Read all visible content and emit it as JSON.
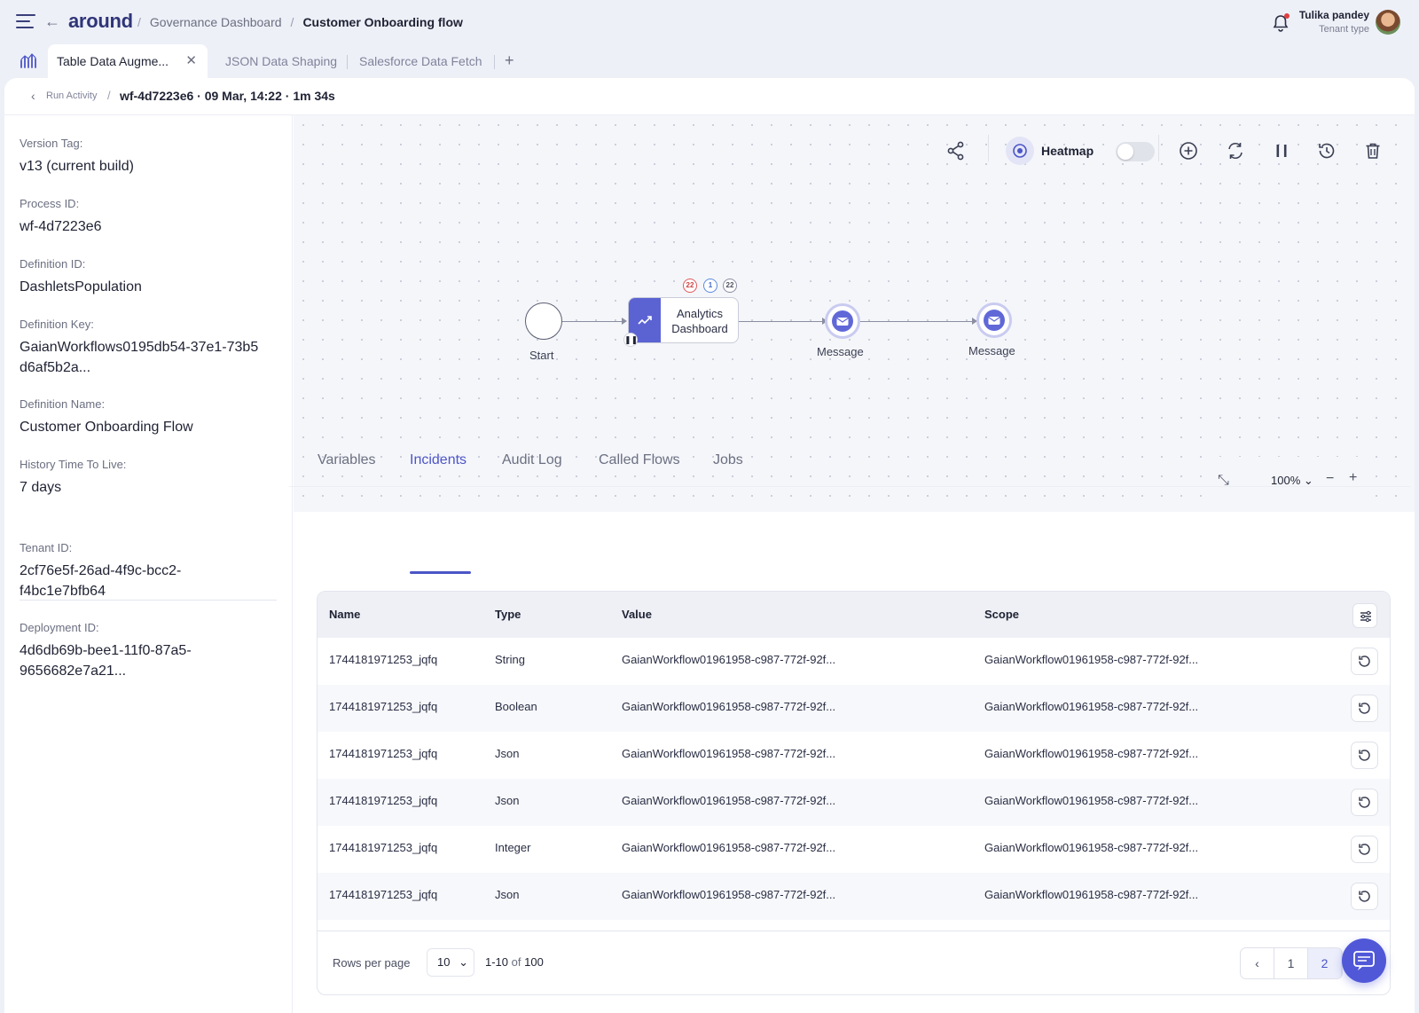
{
  "header": {
    "logo": "around",
    "breadcrumbs": [
      "Governance Dashboard",
      "Customer Onboarding flow"
    ],
    "user_name": "Tulika pandey",
    "user_role": "Tenant type"
  },
  "tabs": [
    {
      "label": "Table Data Augme...",
      "active": true
    },
    {
      "label": "JSON Data Shaping",
      "active": false
    },
    {
      "label": "Salesforce Data Fetch",
      "active": false
    }
  ],
  "run": {
    "back_label": "Run Activity",
    "title": "wf-4d7223e6 · 09 Mar, 14:22 · 1m 34s"
  },
  "details": [
    {
      "label": "Version Tag:",
      "value": "v13 (current build)"
    },
    {
      "label": "Process ID:",
      "value": "wf-4d7223e6"
    },
    {
      "label": "Definition ID:",
      "value": "DashletsPopulation"
    },
    {
      "label": "Definition Key:",
      "value": "GaianWorkflows0195db54-37e1-73b5 d6af5b2a..."
    },
    {
      "label": "Definition Name:",
      "value": "Customer Onboarding Flow"
    },
    {
      "label": "History Time To Live:",
      "value": "7 days"
    },
    {
      "label": "Tenant ID:",
      "value": "2cf76e5f-26ad-4f9c-bcc2-f4bc1e7bfb64"
    },
    {
      "label": "Deployment ID:",
      "value": "4d6db69b-bee1-11f0-87a5-9656682e7a21..."
    }
  ],
  "toolbar": {
    "heatmap_label": "Heatmap",
    "heatmap_on": false
  },
  "diagram": {
    "start_label": "Start",
    "task_label": "Analytics Dashboard",
    "task_badges": [
      "22",
      "1",
      "22"
    ],
    "message1_label": "Message",
    "message2_label": "Message"
  },
  "zoom": {
    "level": "100%"
  },
  "bottom_tabs": [
    "Variables",
    "Incidents",
    "Audit Log",
    "Called Flows",
    "Jobs"
  ],
  "active_bottom_tab": "Incidents",
  "table": {
    "columns": [
      "Name",
      "Type",
      "Value",
      "Scope"
    ],
    "rows": [
      {
        "name": "1744181971253_jqfq",
        "type": "String",
        "value": "GaianWorkflow01961958-c987-772f-92f...",
        "scope": "GaianWorkflow01961958-c987-772f-92f..."
      },
      {
        "name": "1744181971253_jqfq",
        "type": "Boolean",
        "value": "GaianWorkflow01961958-c987-772f-92f...",
        "scope": "GaianWorkflow01961958-c987-772f-92f..."
      },
      {
        "name": "1744181971253_jqfq",
        "type": "Json",
        "value": "GaianWorkflow01961958-c987-772f-92f...",
        "scope": "GaianWorkflow01961958-c987-772f-92f..."
      },
      {
        "name": "1744181971253_jqfq",
        "type": "Json",
        "value": "GaianWorkflow01961958-c987-772f-92f...",
        "scope": "GaianWorkflow01961958-c987-772f-92f..."
      },
      {
        "name": "1744181971253_jqfq",
        "type": "Integer",
        "value": "GaianWorkflow01961958-c987-772f-92f...",
        "scope": "GaianWorkflow01961958-c987-772f-92f..."
      },
      {
        "name": "1744181971253_jqfq",
        "type": "Json",
        "value": "GaianWorkflow01961958-c987-772f-92f...",
        "scope": "GaianWorkflow01961958-c987-772f-92f..."
      }
    ],
    "rows_per_page_label": "Rows per page",
    "rows_per_page": "10",
    "range_start": "1-10",
    "range_of": "of",
    "range_total": "100",
    "pages": [
      "1",
      "2"
    ],
    "current_page": "2"
  },
  "colors": {
    "accent": "#4c55c7",
    "brand": "#2f3578"
  }
}
